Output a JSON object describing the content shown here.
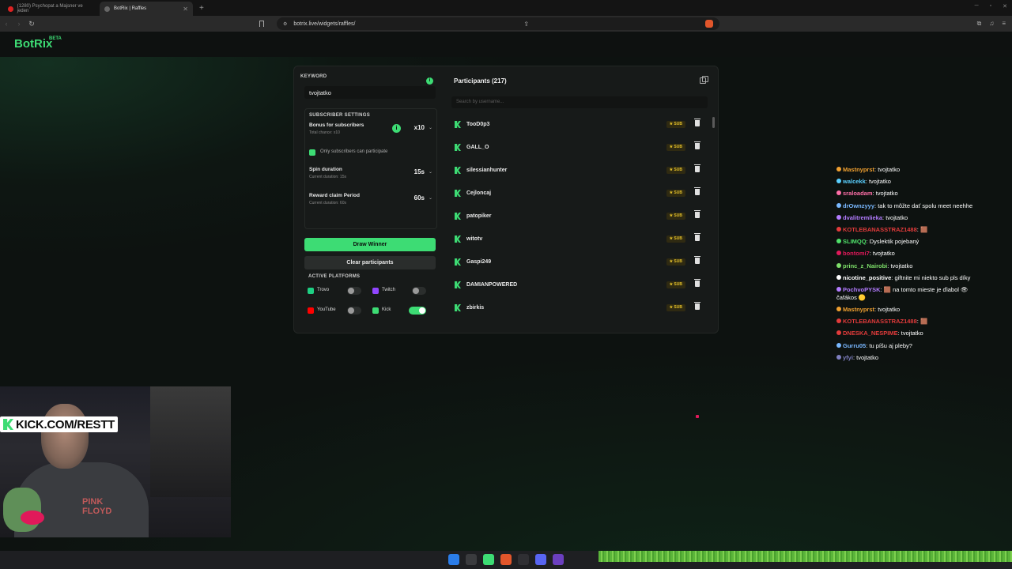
{
  "browser": {
    "tabs": [
      {
        "title": "(1280) Psychopat a Majsner ve jeden",
        "active": false
      },
      {
        "title": "BotRix | Raffles",
        "active": true
      }
    ],
    "url": "botrix.live/widgets/raffles/"
  },
  "brand": {
    "name": "BotRix",
    "badge": "BETA",
    "accent": "#3ddc74"
  },
  "raffle": {
    "keyword_label": "KEYWORD",
    "keyword_value": "tvojtatko",
    "info_symbol": "i",
    "subscriber_settings_title": "SUBSCRIBER SETTINGS",
    "bonus": {
      "title": "Bonus for subscribers",
      "subtitle": "Total chance: x10",
      "value": "x10"
    },
    "only_subs_label": "Only subscribers can participate",
    "spin": {
      "title": "Spin duration",
      "subtitle": "Current duration: 15s",
      "value": "15s"
    },
    "claim": {
      "title": "Reward claim Period",
      "subtitle": "Current duration: 60s",
      "value": "60s"
    },
    "draw_button": "Draw Winner",
    "clear_button": "Clear participants",
    "platforms_title": "ACTIVE PLATFORMS",
    "platforms": [
      {
        "name": "Trovo",
        "enabled": false,
        "color": "#1ecf83"
      },
      {
        "name": "Twitch",
        "enabled": false,
        "color": "#9146ff"
      },
      {
        "name": "YouTube",
        "enabled": false,
        "color": "#ff0000"
      },
      {
        "name": "Kick",
        "enabled": true,
        "color": "#3ddc74"
      }
    ]
  },
  "participants": {
    "title": "Participants (217)",
    "search_placeholder": "Search by username...",
    "sub_badge": "★ SUB",
    "rows": [
      "TooD0p3",
      "GALL_O",
      "silessianhunter",
      "Cejloncaj",
      "patopiker",
      "witotv",
      "Gaspi249",
      "DAMIANPOWERED",
      "zbirkis"
    ]
  },
  "chat": [
    {
      "user": "Mastnyprst",
      "color": "#f0a030",
      "msg": "tvojtatko"
    },
    {
      "user": "walcekk",
      "color": "#5ad0ff",
      "msg": "tvojtatko"
    },
    {
      "user": "sraloadam",
      "color": "#ff6fa8",
      "msg": "tvojtatko"
    },
    {
      "user": "drOwnzyyy",
      "color": "#79b8ff",
      "msg": "tak to môžte dať spolu meet neehhe"
    },
    {
      "user": "dvalitremlieka",
      "color": "#b37cff",
      "msg": "tvojtatko"
    },
    {
      "user": "KOTLEBANASSTRAZ1488",
      "color": "#e23b3b",
      "msg": "🟫"
    },
    {
      "user": "SLIMQQ",
      "color": "#4fe06a",
      "msg": "Dyslektik pojebaný"
    },
    {
      "user": "bontomi7",
      "color": "#e0195a",
      "msg": "tvojtatko"
    },
    {
      "user": "princ_z_Nairobi",
      "color": "#7ee06a",
      "msg": "tvojtatko"
    },
    {
      "user": "nicotine_positive",
      "color": "#ffffff",
      "msg": "giftnite mi niekto sub pls díky"
    },
    {
      "user": "PochvoPYSK",
      "color": "#b37cff",
      "msg": "🟫 na tomto mieste je ďiabol 👁 čafákos 🟡"
    },
    {
      "user": "Mastnyprst",
      "color": "#f0a030",
      "msg": "tvojtatko"
    },
    {
      "user": "KOTLEBANASSTRAZ1488",
      "color": "#e23b3b",
      "msg": "🟫"
    },
    {
      "user": "DNESKA_NESPIME",
      "color": "#e23b3b",
      "msg": "tvojtatko"
    },
    {
      "user": "Gurru05",
      "color": "#79b8ff",
      "msg": "tu píšu aj pleby?"
    },
    {
      "user": "yfyi",
      "color": "#7f7fc0",
      "msg": "tvojtatko"
    }
  ],
  "stream": {
    "kick_banner": "KICK.COM/RESTT",
    "shirt_text": "PINK\nFLOYD"
  }
}
